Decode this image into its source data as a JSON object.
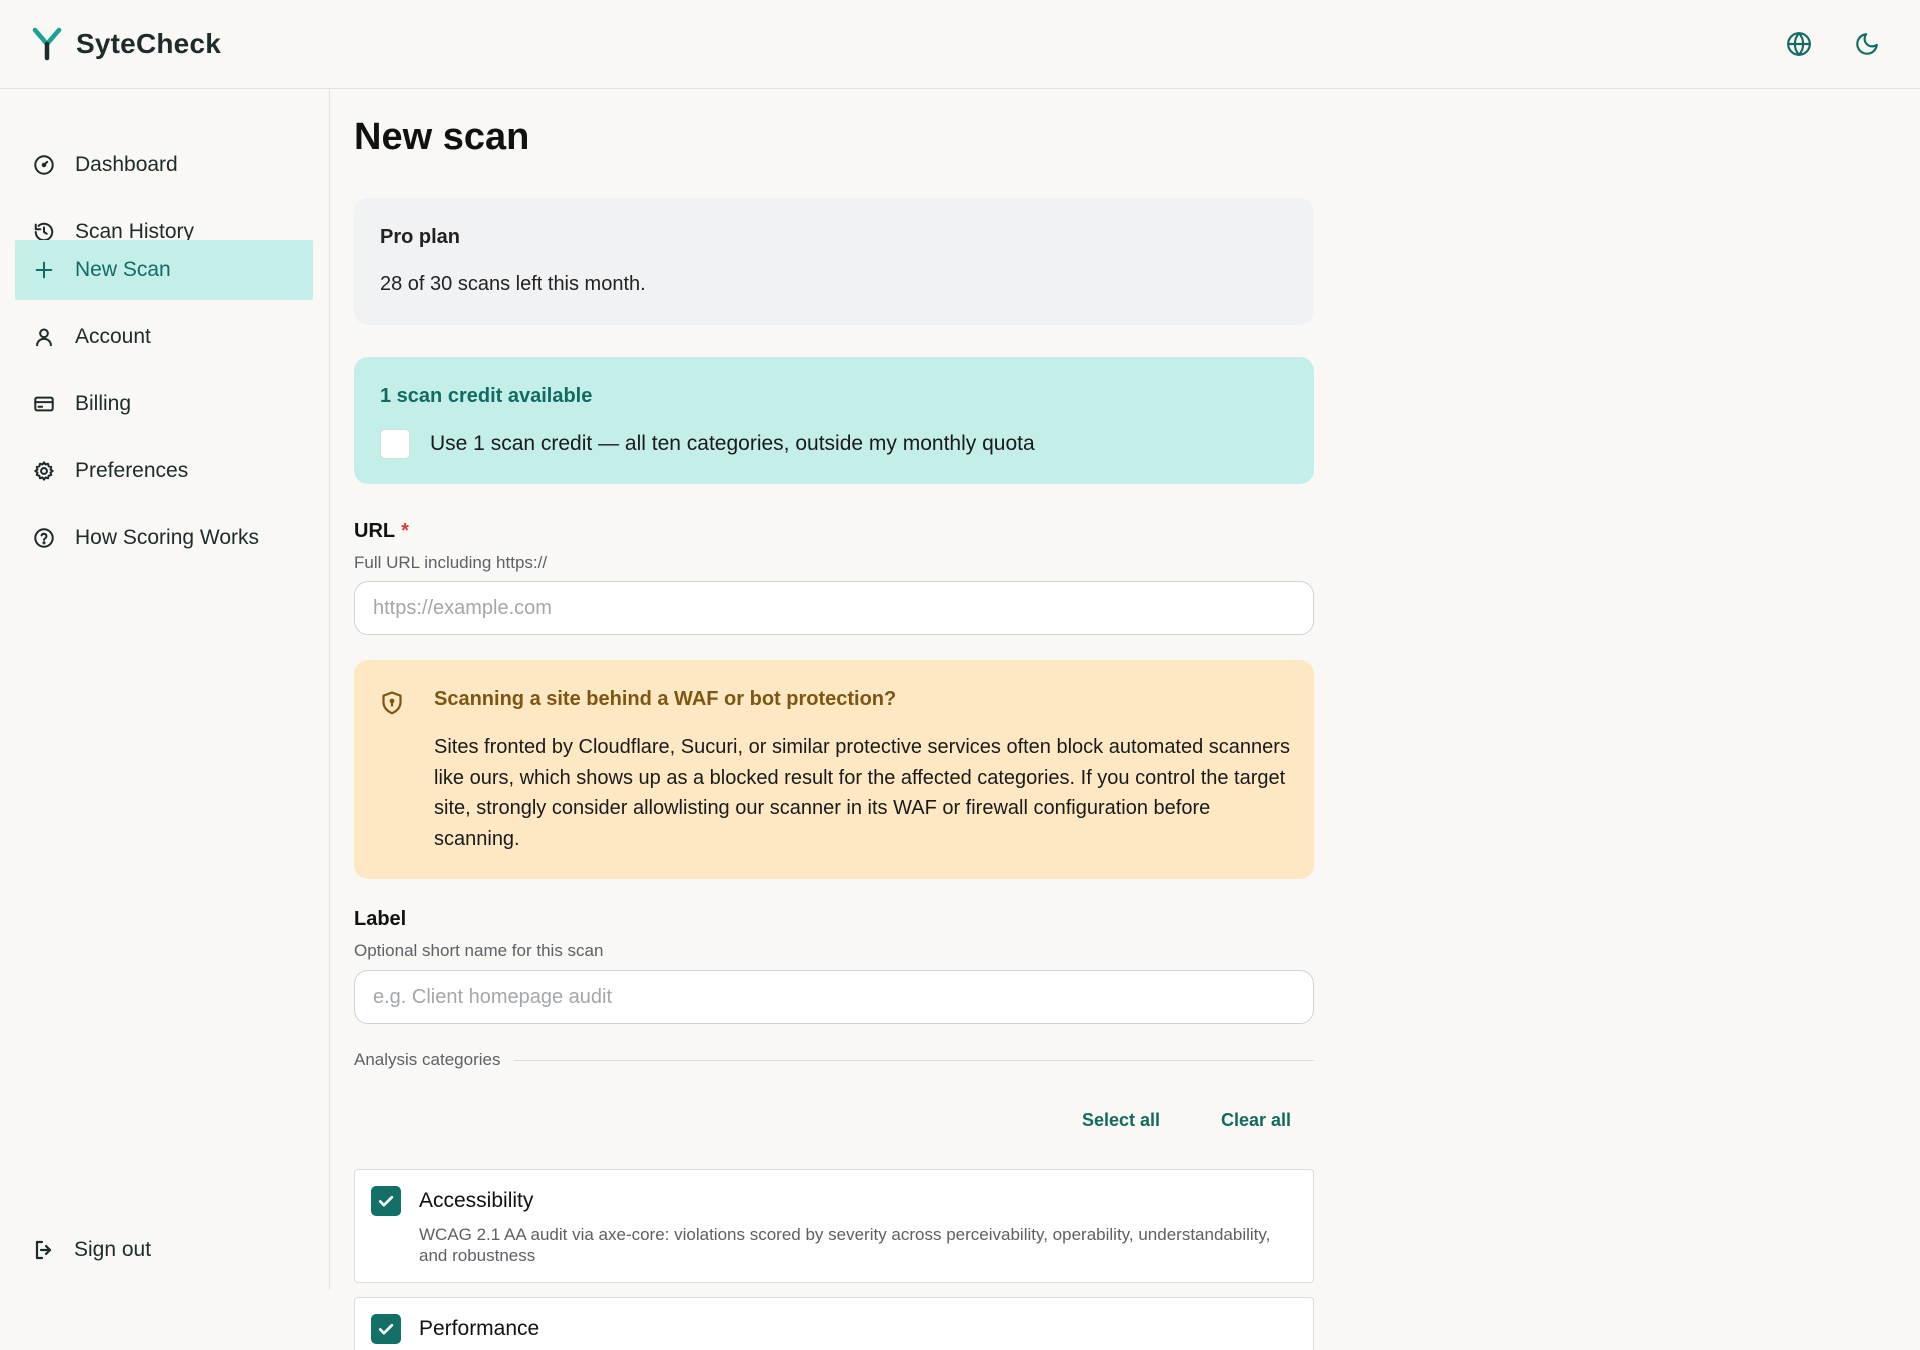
{
  "app": {
    "name": "SyteCheck"
  },
  "header": {
    "globe_icon": "globe-icon",
    "theme_icon": "moon-icon"
  },
  "sidebar": {
    "items": [
      {
        "label": "Dashboard",
        "icon": "gauge-icon"
      },
      {
        "label": "Scan History",
        "icon": "history-icon"
      },
      {
        "label": "New Scan",
        "icon": "plus-icon",
        "active": true
      },
      {
        "label": "Account",
        "icon": "user-icon"
      },
      {
        "label": "Billing",
        "icon": "credit-card-icon"
      },
      {
        "label": "Preferences",
        "icon": "gear-icon"
      },
      {
        "label": "How Scoring Works",
        "icon": "help-circle-icon"
      }
    ],
    "signout_label": "Sign out"
  },
  "main": {
    "title": "New scan",
    "plan": {
      "name": "Pro plan",
      "usage": "28 of 30 scans left this month."
    },
    "credit": {
      "title": "1 scan credit available",
      "checkbox_label": "Use 1 scan credit — all ten categories, outside my monthly quota",
      "checked": false
    },
    "url_field": {
      "label": "URL",
      "required_mark": "*",
      "hint": "Full URL including https://",
      "placeholder": "https://example.com",
      "value": ""
    },
    "waf_notice": {
      "title": "Scanning a site behind a WAF or bot protection?",
      "body": "Sites fronted by Cloudflare, Sucuri, or similar protective services often block automated scanners like ours, which shows up as a blocked result for the affected categories. If you control the target site, strongly consider allowlisting our scanner in its WAF or firewall configuration before scanning."
    },
    "label_field": {
      "label": "Label",
      "hint": "Optional short name for this scan",
      "placeholder": "e.g. Client homepage audit",
      "value": ""
    },
    "categories_section": {
      "title": "Analysis categories",
      "select_all": "Select all",
      "clear_all": "Clear all",
      "items": [
        {
          "name": "Accessibility",
          "description": "WCAG 2.1 AA audit via axe-core: violations scored by severity across perceivability, operability, understandability, and robustness",
          "checked": true
        },
        {
          "name": "Performance",
          "description": "",
          "checked": true
        }
      ]
    }
  },
  "colors": {
    "accent": "#137067",
    "accent_light": "#c4eee8",
    "warning_bg": "#fde8c3",
    "warning_text": "#7d5613",
    "required": "#d33c3c"
  }
}
